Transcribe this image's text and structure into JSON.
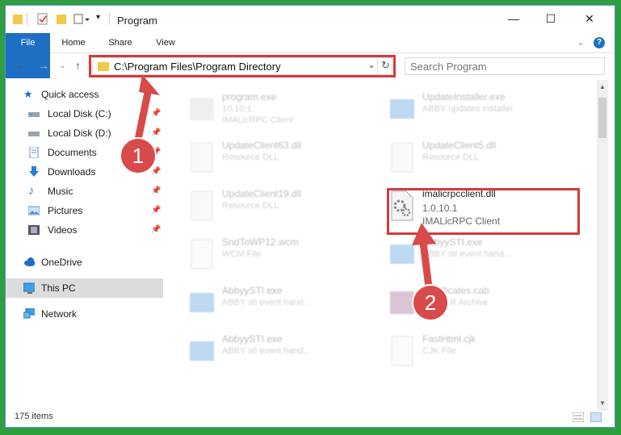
{
  "window": {
    "title": "Program",
    "controls": {
      "minimize": "—",
      "maximize": "☐",
      "close": "✕"
    }
  },
  "ribbon": {
    "tabs": [
      "File",
      "Home",
      "Share",
      "View"
    ],
    "expand_icon": "⌄",
    "help_icon": "?"
  },
  "navigation": {
    "back": "←",
    "forward": "→",
    "recent": "⌄",
    "up": "↑",
    "address": "C:\\Program Files\\Program Directory",
    "address_dropdown": "⌄",
    "refresh": "↻",
    "search_placeholder": "Search Program"
  },
  "sidebar": {
    "items": [
      {
        "label": "Quick access",
        "icon": "star-icon",
        "pinned": false
      },
      {
        "label": "Local Disk (C:)",
        "icon": "drive-icon",
        "pinned": true
      },
      {
        "label": "Local Disk (D:)",
        "icon": "drive-icon",
        "pinned": true
      },
      {
        "label": "Documents",
        "icon": "documents-icon",
        "pinned": true
      },
      {
        "label": "Downloads",
        "icon": "download-icon",
        "pinned": true
      },
      {
        "label": "Music",
        "icon": "music-icon",
        "pinned": true
      },
      {
        "label": "Pictures",
        "icon": "pictures-icon",
        "pinned": true
      },
      {
        "label": "Videos",
        "icon": "videos-icon",
        "pinned": true
      },
      {
        "label": "OneDrive",
        "icon": "cloud-icon",
        "pinned": false
      },
      {
        "label": "This PC",
        "icon": "computer-icon",
        "pinned": false
      },
      {
        "label": "Network",
        "icon": "network-icon",
        "pinned": false
      }
    ],
    "pin_glyph": "📌"
  },
  "files": [
    {
      "name": "program.exe",
      "line2": "10.10.1",
      "line3": "IMALicRPC Client"
    },
    {
      "name": "UpdateInstaller.exe",
      "line2": "ABBY updates installer",
      "line3": ""
    },
    {
      "name": "UpdateClient63.dll",
      "line2": "Resource DLL",
      "line3": ""
    },
    {
      "name": "UpdateClient5.dll",
      "line2": "Resource DLL",
      "line3": ""
    },
    {
      "name": "UpdateClient19.dll",
      "line2": "Resource DLL",
      "line3": ""
    },
    {
      "name": "imalicrpcclient.dll",
      "line2": "1.0.10.1",
      "line3": "IMALicRPC Client"
    },
    {
      "name": "SndToWP12.wcm",
      "line2": "WCM File",
      "line3": ""
    },
    {
      "name": "AbbyySTI.exe",
      "line2": "ABBY sti event hand...",
      "line3": ""
    },
    {
      "name": "AbbyySTI.exe",
      "line2": "ABBY sti event hand...",
      "line3": ""
    },
    {
      "name": "Certificates.cab",
      "line2": "WinRAR Archive",
      "line3": ""
    },
    {
      "name": "AbbyySTI.exe",
      "line2": "ABBY sti event hand...",
      "line3": ""
    },
    {
      "name": "FastHtml.cjk",
      "line2": "CJK File",
      "line3": ""
    }
  ],
  "status": {
    "item_count": "175 items"
  },
  "annotations": {
    "step1": "1",
    "step2": "2"
  },
  "colors": {
    "highlight": "#d33b3b",
    "file_tab": "#1e6fc4",
    "background": "#2f9e3e"
  }
}
